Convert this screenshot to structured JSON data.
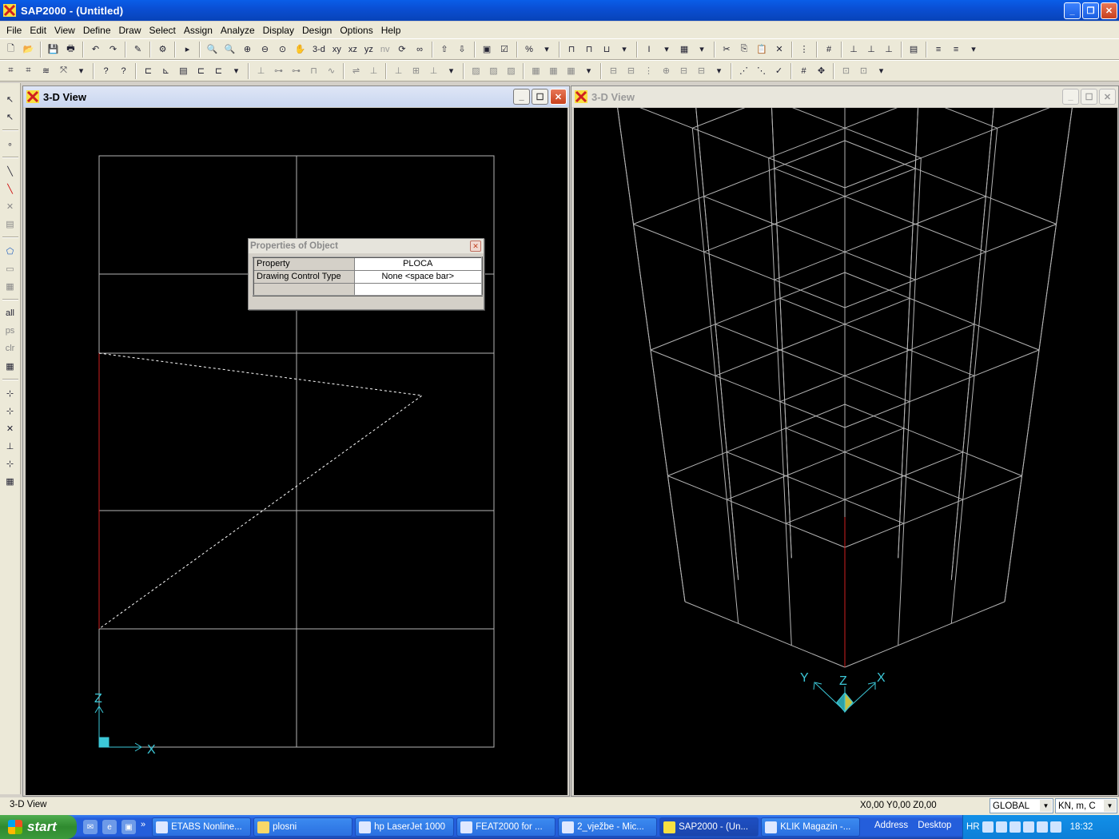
{
  "window": {
    "title": "SAP2000 - (Untitled)"
  },
  "menu": [
    "File",
    "Edit",
    "View",
    "Define",
    "Draw",
    "Select",
    "Assign",
    "Analyze",
    "Display",
    "Design",
    "Options",
    "Help"
  ],
  "toolbar": {
    "view_3d": "3-d",
    "view_xy": "xy",
    "view_xz": "xz",
    "view_yz": "yz",
    "view_nv": "nv"
  },
  "left_view": {
    "title": "3-D View"
  },
  "right_view": {
    "title": "3-D View"
  },
  "properties_popup": {
    "title": "Properties of Object",
    "rows": [
      {
        "key": "Property",
        "value": "PLOCA"
      },
      {
        "key": "Drawing Control Type",
        "value": "None  <space bar>"
      },
      {
        "key": "",
        "value": ""
      }
    ]
  },
  "axes": {
    "left": [
      "Z",
      "X"
    ],
    "right": [
      "Y",
      "Z",
      "X"
    ]
  },
  "statusbar": {
    "text": "3-D View",
    "coords": "X0,00  Y0,00  Z0,00",
    "coord_system": "GLOBAL",
    "units": "KN, m, C"
  },
  "taskbar": {
    "start": "start",
    "more": "»",
    "tasks": [
      "ETABS Nonline...",
      "plosni",
      "hp LaserJet 1000",
      "FEAT2000 for ...",
      "2_vježbe - Mic...",
      "SAP2000 - (Un...",
      "KLIK Magazin -..."
    ],
    "active_task": 5,
    "address": "Address",
    "desktop": "Desktop",
    "language": "HR",
    "clock": "18:32"
  },
  "colors": {
    "grid": "#b4b4b4",
    "highlight": "#d02020",
    "axis": "#3cc8d8",
    "title_blue": "#0a4fd4"
  }
}
